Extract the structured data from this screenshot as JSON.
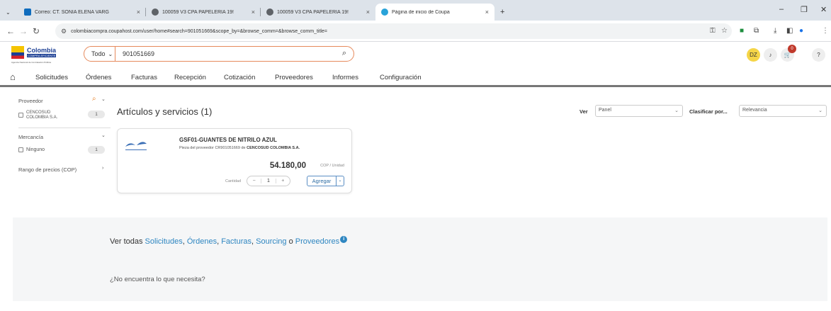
{
  "browser": {
    "tabs": [
      {
        "title": "Correo: CT. SONIA ELENA VARG",
        "icon": "outlook-icon"
      },
      {
        "title": "100059 V3 CPA PAPELERIA 19!",
        "icon": "globe-icon"
      },
      {
        "title": "100059 V3 CPA PAPELERIA 19!",
        "icon": "globe-icon"
      },
      {
        "title": "Página de inicio de Coupa",
        "icon": "coupa-icon"
      }
    ],
    "url": "colombiacompra.coupahost.com/user/home#search=901051669&scope_by=&browse_comm=&browse_comm_title="
  },
  "header": {
    "logo_name": "Colombia",
    "logo_sub": "COMPRA EFICIENTE",
    "logo_caption": "Agencia Nacional de Contratación Pública",
    "search_scope": "Todo",
    "search_value": "901051669",
    "user_initials": "DZ",
    "cart_count": "0",
    "help_label": "?"
  },
  "nav": {
    "items": [
      "Solicitudes",
      "Órdenes",
      "Facturas",
      "Recepción",
      "Cotización",
      "Proveedores",
      "Informes",
      "Configuración"
    ]
  },
  "filters": {
    "proveedor_label": "Proveedor",
    "proveedor_option": "CENCOSUD COLOMBIA S.A.",
    "proveedor_option_l1": "CENCOSUD",
    "proveedor_option_l2": "COLOMBIA S.A.",
    "proveedor_count": "1",
    "mercancia_label": "Mercancía",
    "mercancia_option": "Ninguno",
    "mercancia_count": "1",
    "price_range_label": "Rango de precios (COP)"
  },
  "results": {
    "title": "Artículos y servicios (1)",
    "view_label": "Ver",
    "view_value": "Panel",
    "sort_label": "Clasificar por...",
    "sort_value": "Relevancia"
  },
  "item": {
    "name": "GSF01-GUANTES DE NITRILO AZUL",
    "part_prefix": "Pieza del proveedor CR901051669 de",
    "supplier": "CENCOSUD COLOMBIA S.A.",
    "price": "54.180,00",
    "unit": "COP / Unidad",
    "quantity_label": "Cantidad",
    "quantity": "1",
    "add_label": "Agregar"
  },
  "footer": {
    "ver_todas": "Ver todas",
    "links": [
      "Solicitudes",
      "Órdenes",
      "Facturas",
      "Sourcing",
      "Proveedores"
    ],
    "or_word": "o",
    "not_found": "¿No encuentra lo que necesita?"
  },
  "colors": {
    "accent": "#2e86c1",
    "search_border": "#e68a5c",
    "avatar": "#f5d547",
    "cart_badge": "#c0392b"
  }
}
